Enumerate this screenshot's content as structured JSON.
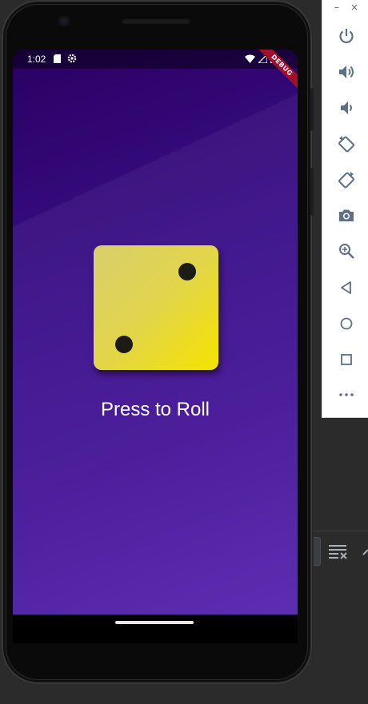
{
  "status_bar": {
    "time": "1:02"
  },
  "debug_banner": "DEBUG",
  "dice": {
    "value": 2
  },
  "prompt_text": "Press to Roll",
  "emulator_window": {
    "minimize": "–",
    "close": "×"
  },
  "emulator_toolbar": {
    "items": [
      {
        "name": "power",
        "icon": "power-icon"
      },
      {
        "name": "volume-up",
        "icon": "volume-up-icon"
      },
      {
        "name": "volume-down",
        "icon": "volume-down-icon"
      },
      {
        "name": "rotate-left",
        "icon": "rotate-left-icon"
      },
      {
        "name": "rotate-right",
        "icon": "rotate-right-icon"
      },
      {
        "name": "screenshot",
        "icon": "camera-icon"
      },
      {
        "name": "zoom",
        "icon": "zoom-icon"
      },
      {
        "name": "back",
        "icon": "back-triangle-icon"
      },
      {
        "name": "home",
        "icon": "home-circle-icon"
      },
      {
        "name": "overview",
        "icon": "overview-square-icon"
      },
      {
        "name": "more",
        "icon": "more-dots-icon"
      }
    ]
  },
  "colors": {
    "screen_top": "#2a0062",
    "screen_bottom": "#5624ae",
    "dice_light": "#d8cf6e",
    "dice_dark": "#f5e300",
    "pip": "#1c1c16",
    "debug_banner": "#a0102a",
    "toolbar_icon": "#5f6f85"
  }
}
